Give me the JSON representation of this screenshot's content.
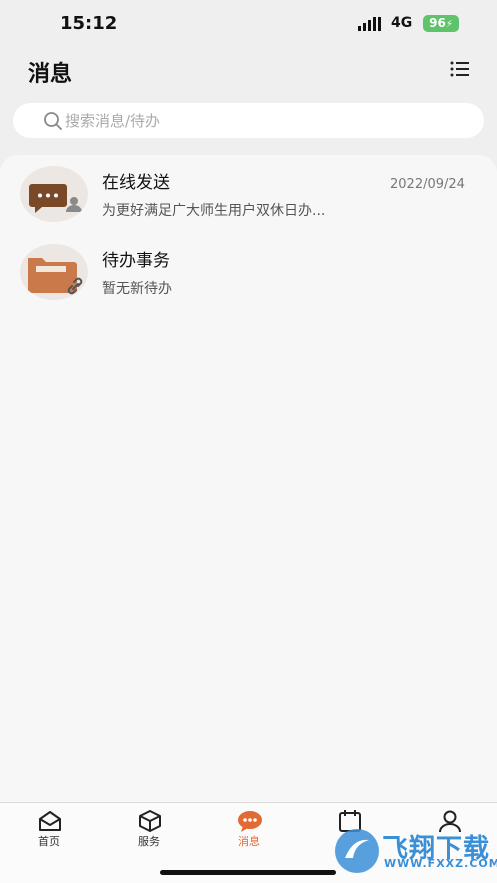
{
  "status_bar": {
    "time": "15:12",
    "network": "4G",
    "battery": "96"
  },
  "header": {
    "title": "消息",
    "menu_icon": "list-menu-icon"
  },
  "search": {
    "placeholder": "搜索消息/待办",
    "value": ""
  },
  "messages": [
    {
      "title": "在线发送",
      "preview": "为更好满足广大师生用户双休日办...",
      "date": "2022/09/24",
      "icon": "chat-user-icon"
    },
    {
      "title": "待办事务",
      "preview": "暂无新待办",
      "date": "",
      "icon": "folder-link-icon"
    }
  ],
  "tabbar": {
    "tabs": [
      {
        "label": "首页",
        "icon": "home-mail-icon",
        "active": false
      },
      {
        "label": "服务",
        "icon": "cube-icon",
        "active": false
      },
      {
        "label": "消息",
        "icon": "message-bubble-icon",
        "active": true
      },
      {
        "label": "",
        "icon": "calendar-icon",
        "active": false
      },
      {
        "label": "",
        "icon": "user-icon",
        "active": false
      }
    ]
  },
  "watermark": {
    "text": "飞翔下载",
    "url": "WWW.FXXZ.COM"
  },
  "colors": {
    "accent": "#e26a35",
    "avatar_brown": "#7a4a28",
    "folder_orange": "#c9794a",
    "battery_green": "#5ec36a"
  }
}
